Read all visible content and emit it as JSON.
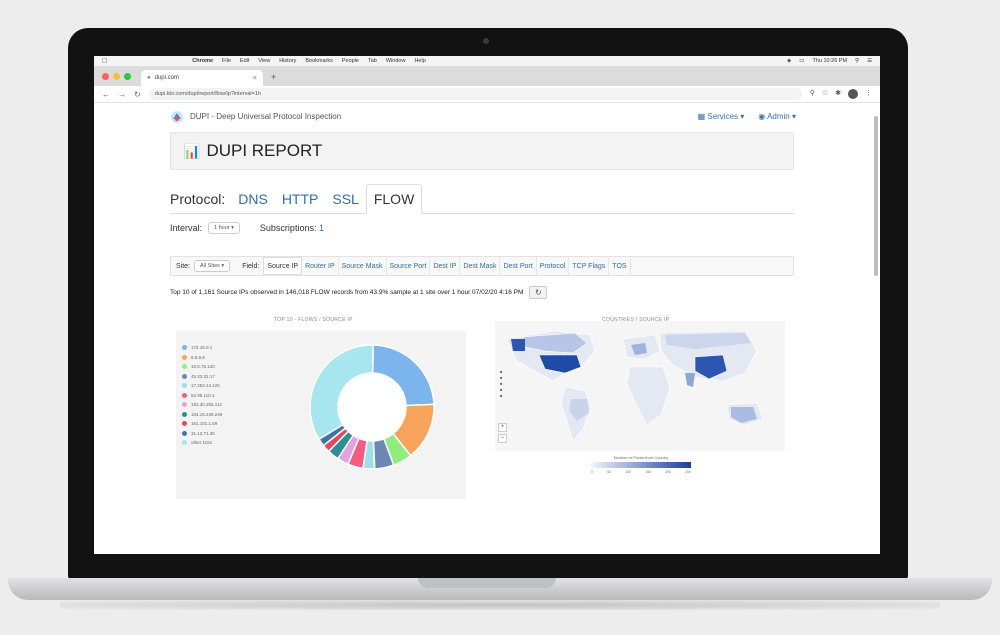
{
  "menubar": {
    "app_name": "Chrome",
    "items": [
      "File",
      "Edit",
      "View",
      "History",
      "Bookmarks",
      "People",
      "Tab",
      "Window",
      "Help"
    ],
    "clock": "Thu 10:26 PM"
  },
  "browser": {
    "tab_title": "dupi.com",
    "new_tab": "+",
    "url": "dupi.kbr.com/dupi/report/flow/ip?interval=1h"
  },
  "app": {
    "brand": "DUPI - Deep Universal Protocol Inspection",
    "nav": {
      "services": "Services",
      "admin": "Admin"
    },
    "report_title": "DUPI REPORT",
    "protocol_label": "Protocol:",
    "protocols": [
      "DNS",
      "HTTP",
      "SSL",
      "FLOW"
    ],
    "active_protocol": "FLOW",
    "interval_label": "Interval:",
    "interval_value": "1 hour",
    "subscriptions_label": "Subscriptions:",
    "subscriptions_value": "1",
    "site_label": "Site:",
    "site_value": "All Sites",
    "field_label": "Field:",
    "fields": [
      "Source IP",
      "Router IP",
      "Source Mask",
      "Source Port",
      "Dest IP",
      "Dest Mask",
      "Dest Port",
      "Protocol",
      "TCP Flags",
      "TOS"
    ],
    "active_field": "Source IP",
    "summary": "Top 10 of 1,161 Source IPs observed in 146,018 FLOW records from 43.9% sample at 1 site over 1 hour 07/02/20 4:16 PM",
    "pie_title": "TOP 10 - FLOWS / SOURCE IP",
    "map_title": "COUNTRIES / SOURCE IP",
    "map_scale_caption": "Number of Flows from Country",
    "map_scale_ticks": [
      "0",
      "50",
      "100",
      "150",
      "200",
      "250"
    ]
  },
  "chart_data": {
    "type": "pie",
    "title": "TOP 10 - FLOWS / SOURCE IP",
    "series": [
      {
        "name": "172.16.0.1",
        "value": 24,
        "color": "#7cb5ec"
      },
      {
        "name": "8.8.8.8",
        "value": 15,
        "color": "#f7a35c"
      },
      {
        "name": "10.0.75.120",
        "value": 5,
        "color": "#90ed7d"
      },
      {
        "name": "45.33.32.17",
        "value": 5,
        "color": "#6c87b5"
      },
      {
        "name": "17.253.14.125",
        "value": 3,
        "color": "#9fe0e8"
      },
      {
        "name": "52.95.110.1",
        "value": 4,
        "color": "#f15c80"
      },
      {
        "name": "192.30.255.112",
        "value": 3,
        "color": "#e4a2e0"
      },
      {
        "name": "104.16.249.249",
        "value": 3,
        "color": "#2b908f"
      },
      {
        "name": "151.101.1.69",
        "value": 2,
        "color": "#e4485a"
      },
      {
        "name": "31.13.71.36",
        "value": 2,
        "color": "#4572a7"
      },
      {
        "name": "other 1151",
        "value": 34,
        "color": "#a8e6ef"
      }
    ]
  }
}
